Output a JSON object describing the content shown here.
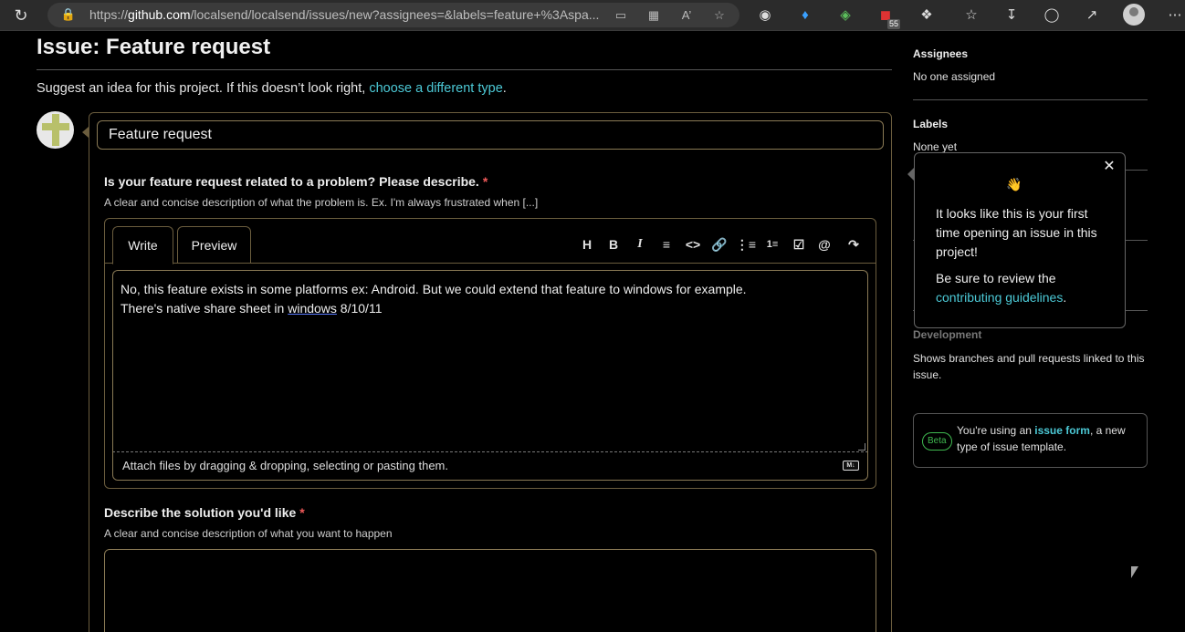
{
  "browser": {
    "url_prefix": "https://",
    "url_host": "github.com",
    "url_path": "/localsend/localsend/issues/new?assignees=&labels=feature+%3Aspa...",
    "extension_badge": "55"
  },
  "page": {
    "title": "Issue: Feature request",
    "suggest_text": "Suggest an idea for this project. If this doesn’t look right, ",
    "suggest_link": "choose a different type",
    "suggest_end": "."
  },
  "form": {
    "title_value": "Feature request",
    "q1": {
      "label": "Is your feature request related to a problem? Please describe.",
      "required_mark": "*",
      "description": "A clear and concise description of what the problem is. Ex. I'm always frustrated when [...]"
    },
    "tabs": {
      "write": "Write",
      "preview": "Preview"
    },
    "toolbar": [
      "heading-icon",
      "bold-icon",
      "italic-icon",
      "quote-icon",
      "code-icon",
      "link-icon",
      "bulleted-list-icon",
      "numbered-list-icon",
      "task-list-icon",
      "mention-icon",
      "reference-icon"
    ],
    "editor_text_line1": "No, this feature exists in some platforms ex: Android. But we could extend that feature to windows for example.",
    "editor_text_line2_a": "There's native share sheet in ",
    "editor_text_line2_u": "windows",
    "editor_text_line2_b": " 8/10/11",
    "attach_text": "Attach files by dragging & dropping, selecting or pasting them.",
    "markdown_badge": "M↓",
    "q2": {
      "label": "Describe the solution you'd like",
      "required_mark": "*",
      "description": "A clear and concise description of what you want to happen"
    }
  },
  "sidebar": {
    "assignees_heading": "Assignees",
    "assignees_value": "No one assigned",
    "labels_heading": "Labels",
    "labels_value": "None yet",
    "development_heading": "Development",
    "development_desc": "Shows branches and pull requests linked to this issue.",
    "beta_badge": "Beta",
    "beta_text_a": "You're using an ",
    "beta_link": "issue form",
    "beta_text_b": ", a new type of issue template."
  },
  "popover": {
    "wave": "👋",
    "p1": "It looks like this is your first time opening an issue in this project!",
    "p2_a": "Be sure to review the ",
    "p2_link": "contributing guidelines",
    "p2_b": "."
  },
  "colors": {
    "accent_link": "#4cc9d6",
    "required": "#f05a5a",
    "beta": "#3fb950",
    "border": "#6b5d3e"
  }
}
